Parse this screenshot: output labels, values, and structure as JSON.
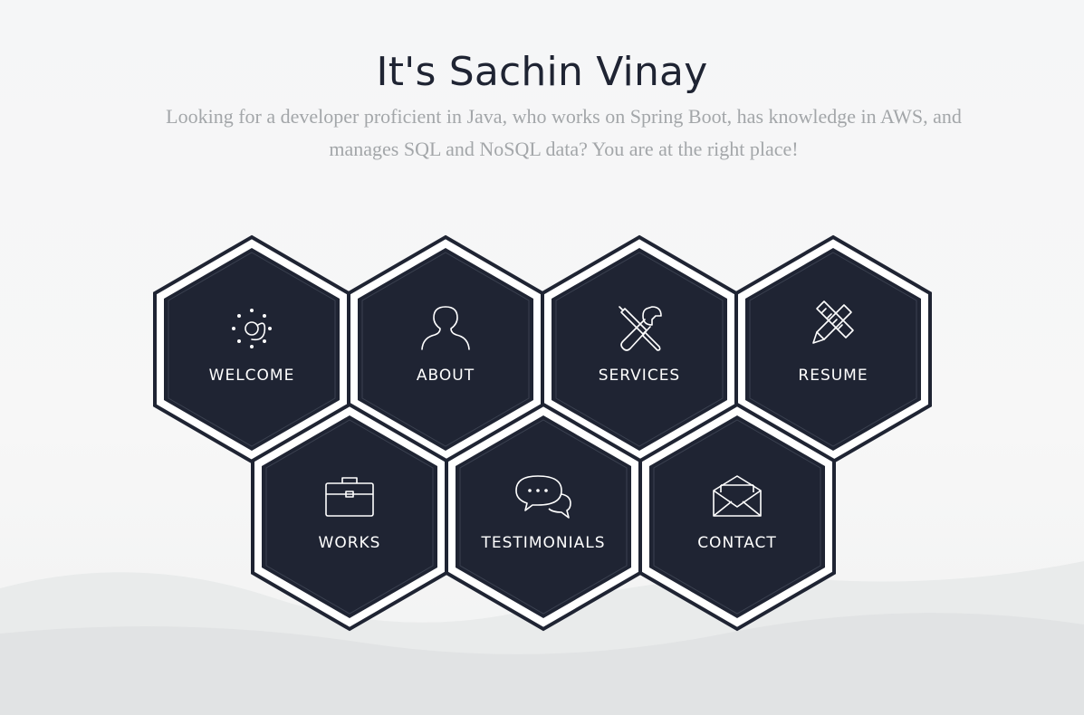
{
  "header": {
    "title": "It's Sachin Vinay",
    "subtitle": "Looking for a developer proficient in Java, who works on Spring Boot, has knowledge in AWS, and manages SQL and NoSQL data? You are at the right place!"
  },
  "nav": {
    "items": [
      {
        "key": "welcome",
        "label": "WELCOME",
        "icon": "sun-icon"
      },
      {
        "key": "about",
        "label": "ABOUT",
        "icon": "user-icon"
      },
      {
        "key": "services",
        "label": "SERVICES",
        "icon": "tools-icon"
      },
      {
        "key": "resume",
        "label": "RESUME",
        "icon": "pencil-ruler-icon"
      },
      {
        "key": "works",
        "label": "WORKS",
        "icon": "briefcase-icon"
      },
      {
        "key": "testimonials",
        "label": "TESTIMONIALS",
        "icon": "chat-bubbles-icon"
      },
      {
        "key": "contact",
        "label": "CONTACT",
        "icon": "envelope-icon"
      }
    ]
  },
  "colors": {
    "hex_fill": "#1f2433",
    "hex_border": "#1f2433",
    "label": "#ffffff",
    "title": "#1f2433",
    "subtitle": "#a3a6a9"
  }
}
